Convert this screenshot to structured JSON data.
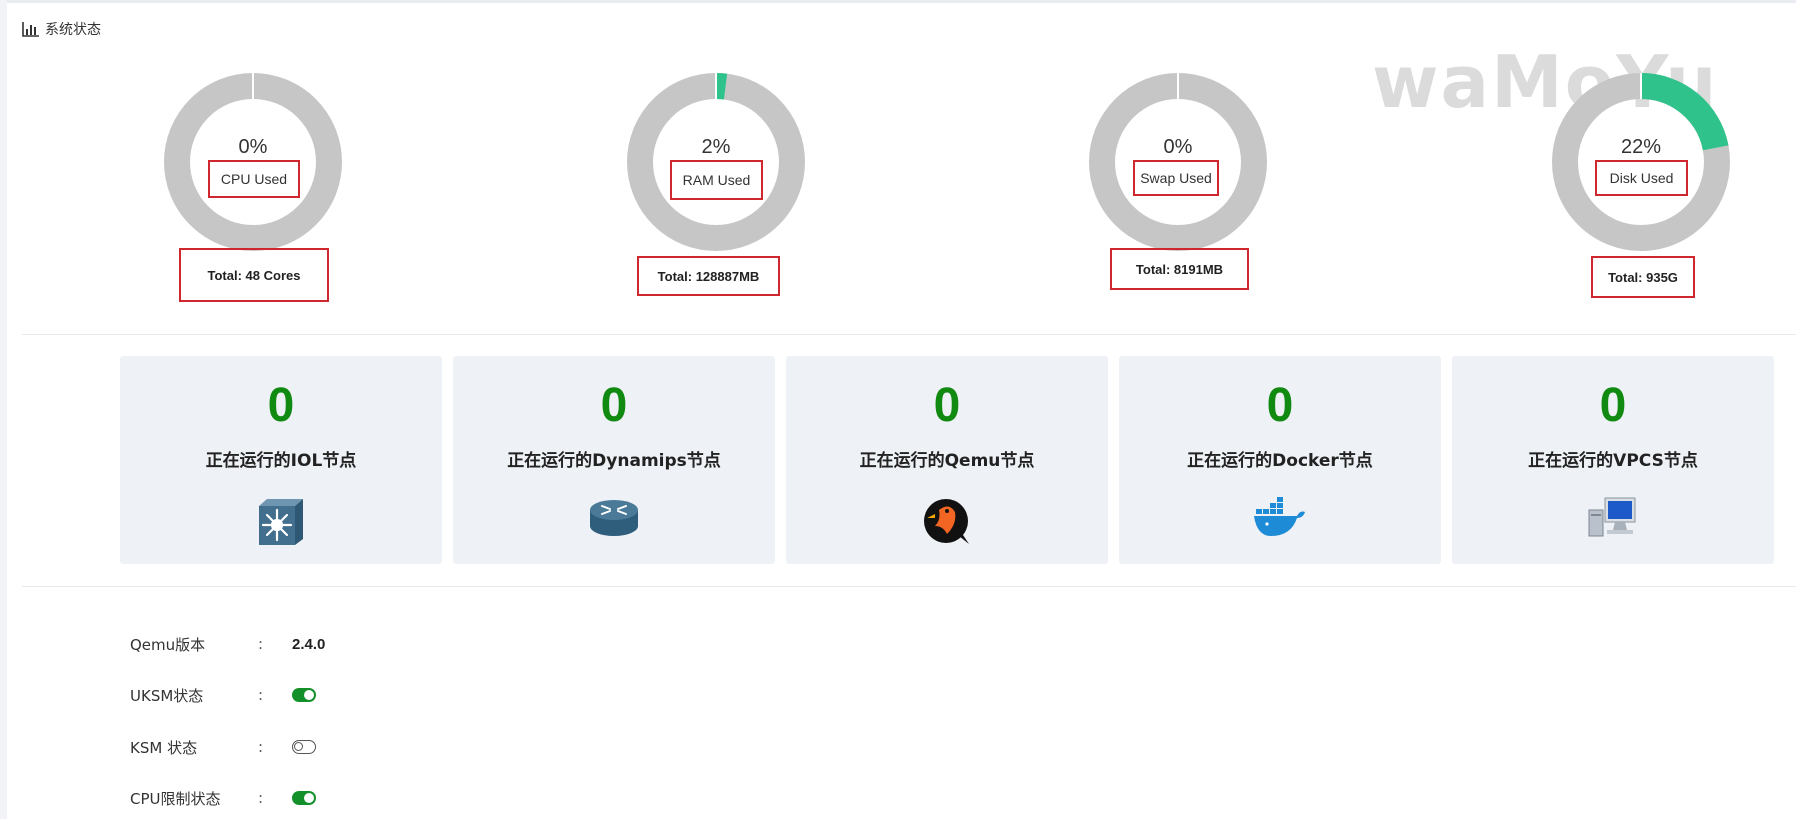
{
  "panel": {
    "title": "系统状态",
    "icon": "bar-chart-icon"
  },
  "watermark": "waMoYu",
  "gauges": [
    {
      "percent": "0%",
      "fraction": 0.0,
      "label": "CPU Used",
      "total": "Total: 48 Cores"
    },
    {
      "percent": "2%",
      "fraction": 0.02,
      "label": "RAM Used",
      "total": "Total: 128887MB"
    },
    {
      "percent": "0%",
      "fraction": 0.0,
      "label": "Swap Used",
      "total": "Total: 8191MB"
    },
    {
      "percent": "22%",
      "fraction": 0.22,
      "label": "Disk Used",
      "total": "Total: 935G"
    }
  ],
  "nodes": [
    {
      "count": "0",
      "label": "正在运行的IOL节点",
      "icon": "switch-icon"
    },
    {
      "count": "0",
      "label": "正在运行的Dynamips节点",
      "icon": "router-icon"
    },
    {
      "count": "0",
      "label": "正在运行的Qemu节点",
      "icon": "qemu-icon"
    },
    {
      "count": "0",
      "label": "正在运行的Docker节点",
      "icon": "docker-icon"
    },
    {
      "count": "0",
      "label": "正在运行的VPCS节点",
      "icon": "vpcs-icon"
    }
  ],
  "info": [
    {
      "key": "Qemu版本",
      "colon": ":",
      "value": "2.4.0"
    },
    {
      "key": "UKSM状态",
      "colon": ":",
      "state": "on"
    },
    {
      "key": "KSM 状态",
      "colon": ":",
      "state": "off"
    },
    {
      "key": "CPU限制状态",
      "colon": ":",
      "state": "on"
    }
  ],
  "colors": {
    "gauge_track": "#c6c6c6",
    "gauge_fill": "#2fc38b",
    "count_green": "#118a11",
    "highlight_red": "#d0262e",
    "toggle_on": "#14902b"
  }
}
